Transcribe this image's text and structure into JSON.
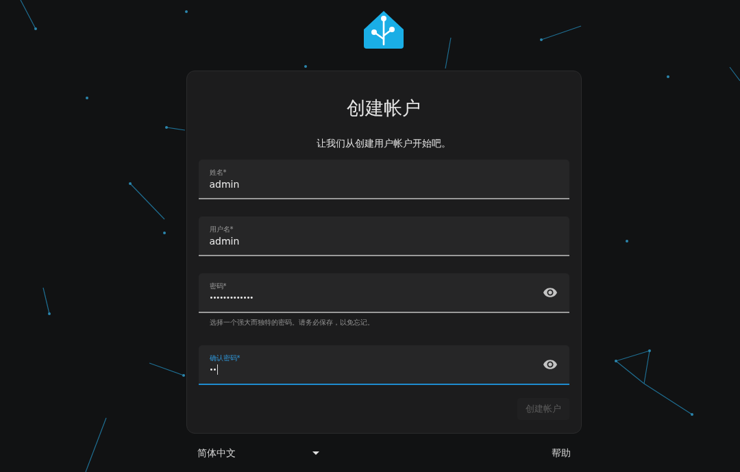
{
  "card": {
    "title": "创建帐户",
    "subtitle": "让我们从创建用户帐户开始吧。",
    "fields": [
      {
        "label": "姓名*",
        "value": "admin",
        "kind": "text",
        "focused": false
      },
      {
        "label": "用户名*",
        "value": "admin",
        "kind": "text",
        "focused": false
      },
      {
        "label": "密码*",
        "value": "•••••••••••••",
        "kind": "password",
        "focused": false,
        "helper": "选择一个强大而独特的密码。请务必保存，以免忘记。"
      },
      {
        "label": "确认密码*",
        "value": "••",
        "kind": "password",
        "focused": true
      }
    ],
    "submit": {
      "label": "创建帐户",
      "disabled": true
    }
  },
  "footer": {
    "language": "简体中文",
    "help": "帮助"
  }
}
